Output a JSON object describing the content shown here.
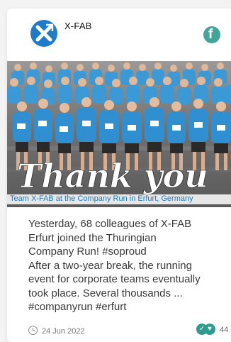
{
  "account": {
    "name": "X-FAB"
  },
  "photo": {
    "overlay_text": "Thank you",
    "caption": "Team X-FAB at the Company Run in Erfurt, Germany"
  },
  "post": {
    "lines": [
      "Yesterday, 68 colleagues of X-FAB",
      "Erfurt joined the Thuringian",
      "Company Run! #soproud",
      "After a two-year break, the running",
      "event for corporate teams eventually",
      "took place. Several thousands ...",
      "#companyrun #erfurt"
    ],
    "date": "24 Jun 2022",
    "reaction_count": "44"
  },
  "icons": {
    "brand_logo": "x-fab-logo-icon",
    "network": "facebook-icon",
    "time": "clock-icon",
    "reactions": "like-love-reaction-icons"
  },
  "colors": {
    "brand_blue": "#1e7bc8",
    "facebook_teal": "#43a59a",
    "caption_blue": "#1a78c6"
  }
}
